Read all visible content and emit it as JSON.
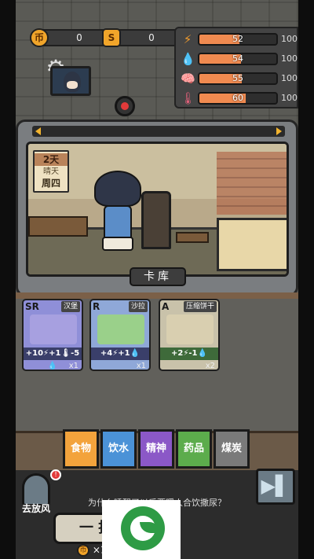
{
  "currency": {
    "coins": "0",
    "coin_icon": "币",
    "tickets": "0",
    "ticket_icon": "S"
  },
  "stats": [
    {
      "name": "energy",
      "icon": "⚡",
      "value": "52",
      "max": "100",
      "fraction": 0.52
    },
    {
      "name": "water",
      "icon": "💧",
      "value": "54",
      "max": "100",
      "fraction": 0.54
    },
    {
      "name": "mind",
      "icon": "🧠",
      "value": "55",
      "max": "100",
      "fraction": 0.55
    },
    {
      "name": "temperature",
      "icon": "🌡",
      "value": "60",
      "max": "100",
      "fraction": 0.6
    }
  ],
  "calendar": {
    "day": "2天",
    "weather": "晴天",
    "weekday": "周四"
  },
  "storage_title": "卡库",
  "cards": [
    {
      "rarity": "SR",
      "name": "汉堡",
      "effect": "+10⚡+1🌡-5💧",
      "count": "x1"
    },
    {
      "rarity": "R",
      "name": "沙拉",
      "effect": "+4⚡+1💧",
      "count": "x1"
    },
    {
      "rarity": "A",
      "name": "压缩饼干",
      "effect": "+2⚡-1💧",
      "count": "x2"
    }
  ],
  "categories": [
    {
      "label": "食物",
      "active": true
    },
    {
      "label": "饮水",
      "active": false
    },
    {
      "label": "精神",
      "active": false
    },
    {
      "label": "药品",
      "active": false
    },
    {
      "label": "煤炭",
      "active": false
    }
  ],
  "bottom": {
    "go_out_label": "去放风",
    "badge": "!",
    "tip": "为什么睡醒了以后要暖人合饮撒尿？",
    "draw_label": "一 抽",
    "draw_cost": "×10",
    "next_icon": "▶▌"
  }
}
